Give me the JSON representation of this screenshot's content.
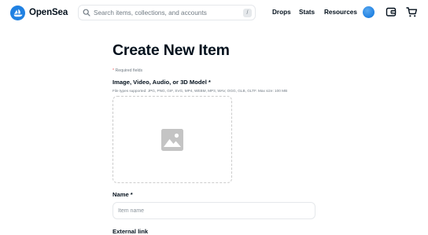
{
  "header": {
    "brand_name": "OpenSea",
    "search": {
      "placeholder": "Search items, collections, and accounts",
      "shortcut_key": "/"
    },
    "nav": {
      "drops": "Drops",
      "stats": "Stats",
      "resources": "Resources"
    },
    "icons": [
      "opensea-logo-icon",
      "search-icon",
      "profile-avatar",
      "wallet-icon",
      "cart-icon"
    ],
    "accent_color": "#2081e2"
  },
  "form": {
    "title": "Create New Item",
    "required_star": "*",
    "required_note": "Required fields",
    "media": {
      "label": "Image, Video, Audio, or 3D Model *",
      "file_types": "File types supported: JPG, PNG, GIF, SVG, MP4, WEBM, MP3, WAV, OGG, GLB, GLTF. Max size: 100 MB",
      "placeholder_icon": "image-icon"
    },
    "name": {
      "label": "Name *",
      "placeholder": "Item name",
      "value": ""
    },
    "external_link": {
      "label": "External link"
    }
  }
}
